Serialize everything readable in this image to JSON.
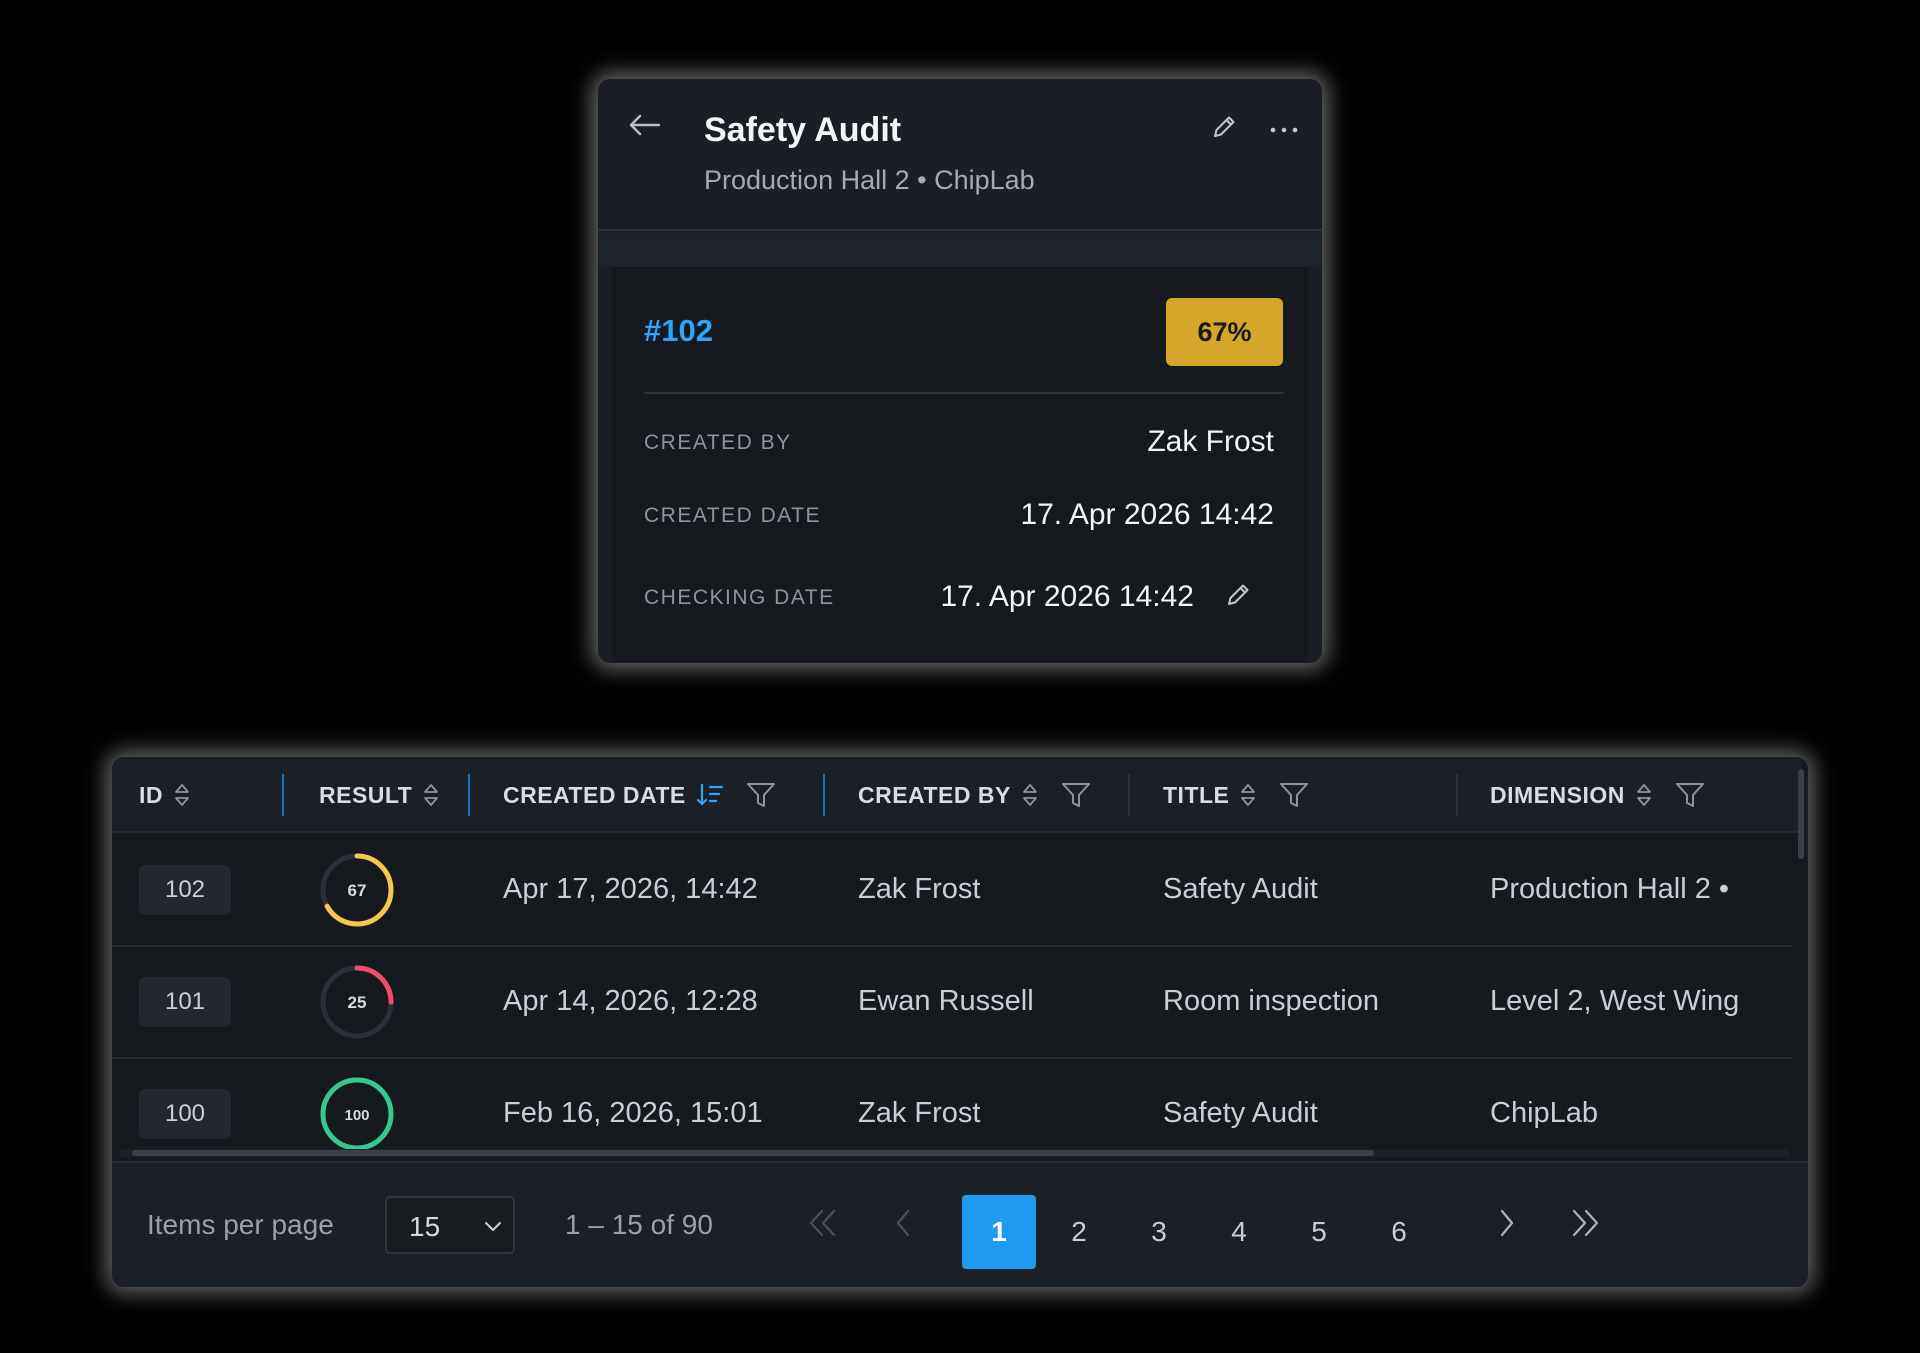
{
  "card": {
    "title": "Safety Audit",
    "subtitle": "Production Hall 2 • ChipLab",
    "audit_id": "#102",
    "progress_label": "67%",
    "progress_color": "#d4a62a",
    "fields": {
      "created_by_label": "CREATED BY",
      "created_by_value": "Zak Frost",
      "created_date_label": "CREATED DATE",
      "created_date_value": "17. Apr 2026 14:42",
      "checking_date_label": "CHECKING DATE",
      "checking_date_value": "17. Apr 2026 14:42"
    },
    "icons": [
      "arrow-left-icon",
      "pencil-icon",
      "more-horizontal-icon"
    ]
  },
  "table": {
    "columns": {
      "id": "ID",
      "result": "RESULT",
      "created_date": "CREATED DATE",
      "created_by": "CREATED BY",
      "title": "TITLE",
      "dimension": "DIMENSION"
    },
    "sorted_column": "created_date",
    "sort_direction": "descending",
    "rows": [
      {
        "id": "102",
        "result": "67",
        "result_fraction": 0.67,
        "result_color": "#f2c94c",
        "created_date": "Apr 17, 2026, 14:42",
        "created_by": "Zak Frost",
        "title": "Safety Audit",
        "dimension": "Production Hall 2 •"
      },
      {
        "id": "101",
        "result": "25",
        "result_fraction": 0.25,
        "result_color": "#ef4e6a",
        "created_date": "Apr 14, 2026, 12:28",
        "created_by": "Ewan Russell",
        "title": "Room inspection",
        "dimension": "Level 2, West Wing"
      },
      {
        "id": "100",
        "result": "100",
        "result_fraction": 1.0,
        "result_color": "#34c98e",
        "created_date": "Feb 16, 2026, 15:01",
        "created_by": "Zak Frost",
        "title": "Safety Audit",
        "dimension": "ChipLab"
      }
    ],
    "footer": {
      "items_per_page_label": "Items per page",
      "items_per_page_value": "15",
      "range_label": "1 – 15 of 90",
      "pages": [
        "1",
        "2",
        "3",
        "4",
        "5",
        "6"
      ],
      "active_page": "1",
      "accent_color": "#1e9bf0"
    }
  }
}
